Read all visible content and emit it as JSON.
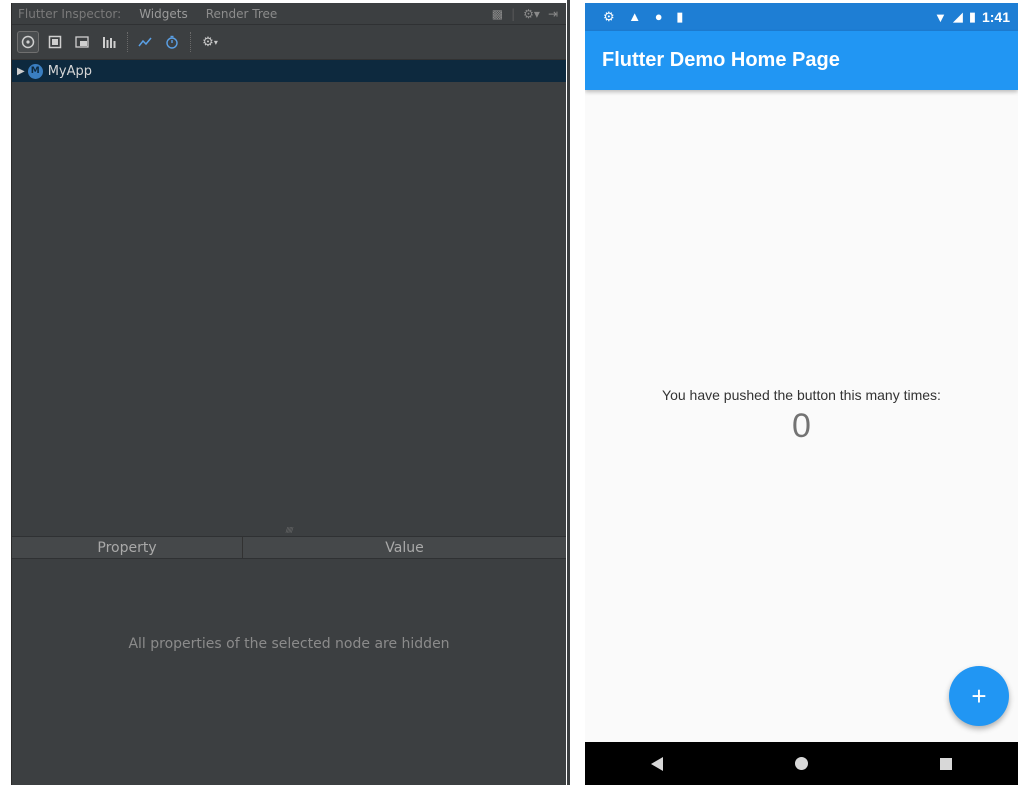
{
  "ide": {
    "tabs": [
      {
        "label": "Flutter Inspector:"
      },
      {
        "label": "Widgets"
      },
      {
        "label": "Render Tree"
      }
    ],
    "tab_tools": {
      "message_icon": "message-icon",
      "gear_icon": "gear-dropdown-icon",
      "hide_icon": "hide-panel-icon"
    },
    "toolbar": {
      "icons": [
        "select-widget-icon",
        "debug-paint-icon",
        "repaint-rainbow-icon",
        "performance-overlay-icon",
        "timeline-icon",
        "slow-animations-icon",
        "settings-dropdown-icon"
      ]
    },
    "tree": {
      "root": {
        "badge": "M",
        "label": "MyApp"
      }
    },
    "properties": {
      "col_property": "Property",
      "col_value": "Value",
      "empty_message": "All properties of the selected node are hidden"
    },
    "colors": {
      "panel": "#3c3f41",
      "selected_row": "#0d293e"
    }
  },
  "phone": {
    "status_bar": {
      "left_icons": [
        "settings-icon",
        "warning-icon",
        "circle-icon",
        "sd-card-icon"
      ],
      "right_icons": [
        "wifi-icon",
        "signal-icon",
        "battery-icon"
      ],
      "time": "1:41"
    },
    "app_bar": {
      "title": "Flutter Demo Home Page"
    },
    "body": {
      "caption": "You have pushed the button this many times:",
      "counter": "0"
    },
    "fab": {
      "label": "+"
    },
    "colors": {
      "primary": "#2196f3",
      "status": "#1e7ed4"
    }
  }
}
